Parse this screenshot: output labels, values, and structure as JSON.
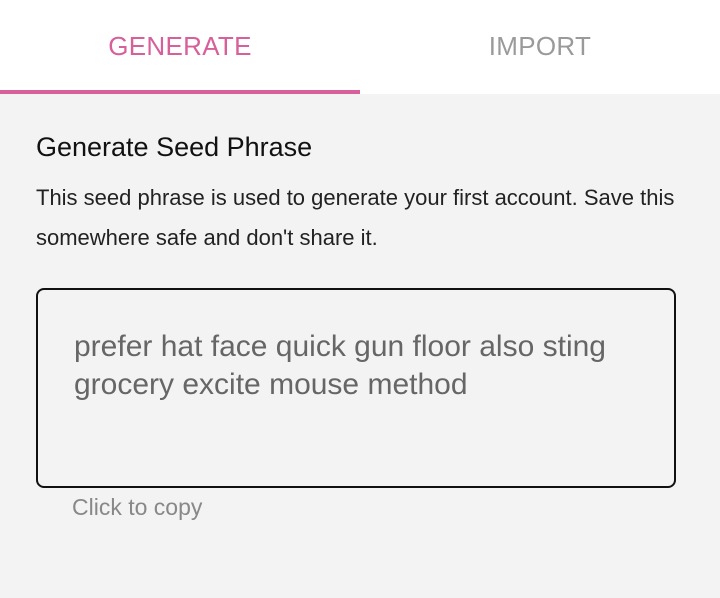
{
  "tabs": {
    "generate_label": "GENERATE",
    "import_label": "IMPORT",
    "active": "GENERATE"
  },
  "main": {
    "heading": "Generate Seed Phrase",
    "description": "This seed phrase is used to generate your first account. Save this somewhere safe and don't share it.",
    "seed_phrase": "prefer hat face quick gun floor also sting grocery excite mouse method",
    "copy_hint": "Click to copy"
  },
  "colors": {
    "accent": "#d7609a",
    "inactive_tab": "#9a9a9a",
    "background": "#f3f3f3"
  }
}
